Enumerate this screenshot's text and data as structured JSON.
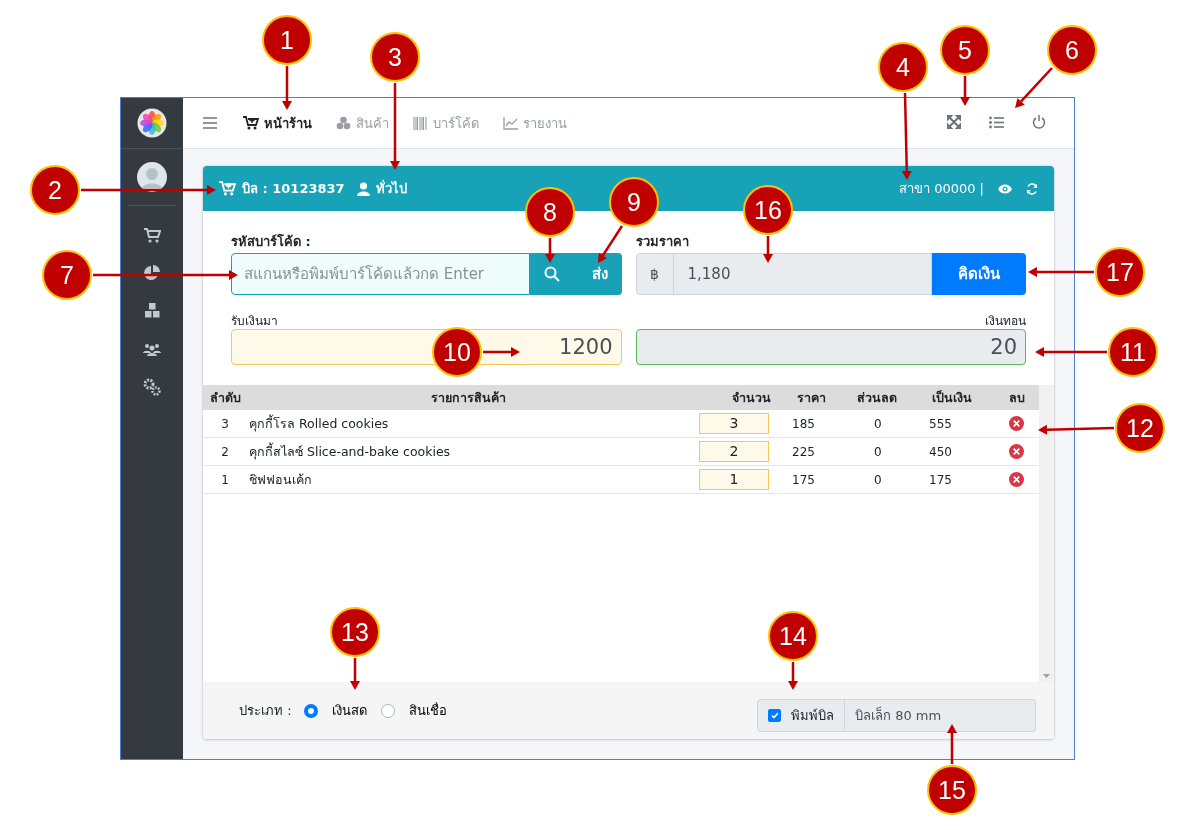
{
  "nav": {
    "items": [
      {
        "label": "หน้าร้าน",
        "selected": true
      },
      {
        "label": "สินค้า",
        "selected": false
      },
      {
        "label": "บาร์โค้ด",
        "selected": false
      },
      {
        "label": "รายงาน",
        "selected": false
      }
    ]
  },
  "bill_header": {
    "bill": "บิล : 10123837",
    "customer": "ทั่วไป",
    "branch": "สาขา 00000 |"
  },
  "barcode": {
    "label": "รหัสบาร์โค้ด :",
    "placeholder": "สแกนหรือพิมพ์บาร์โค้ดแล้วกด Enter",
    "send_button": "ส่ง"
  },
  "total": {
    "label": "รวมราคา",
    "currency": "฿",
    "value": "1,180",
    "button": "คิดเงิน"
  },
  "received": {
    "label": "รับเงินมา",
    "value": "1200"
  },
  "change": {
    "label": "เงินทอน",
    "value": "20"
  },
  "table": {
    "columns": [
      "ลำดับ",
      "รายการสินค้า",
      "จำนวน",
      "ราคา",
      "ส่วนลด",
      "เป็นเงิน",
      "ลบ"
    ],
    "rows": [
      {
        "no": "3",
        "name": "คุกกี้โรล Rolled cookies",
        "qty": "3",
        "price": "185",
        "discount": "0",
        "amount": "555"
      },
      {
        "no": "2",
        "name": "คุกกี้สไลซ์ Slice-and-bake cookies",
        "qty": "2",
        "price": "225",
        "discount": "0",
        "amount": "450"
      },
      {
        "no": "1",
        "name": "ชิฟฟอนเค้ก",
        "qty": "1",
        "price": "175",
        "discount": "0",
        "amount": "175"
      }
    ]
  },
  "payment_type": {
    "label": "ประเภท :",
    "options": [
      {
        "label": "เงินสด",
        "selected": true
      },
      {
        "label": "สินเชื่อ",
        "selected": false
      }
    ]
  },
  "print": {
    "label": "พิมพ์บิล",
    "checked": true,
    "paper": "บิลเล็ก 80 mm"
  },
  "callouts": [
    {
      "number": "1"
    },
    {
      "number": "2"
    },
    {
      "number": "3"
    },
    {
      "number": "4"
    },
    {
      "number": "5"
    },
    {
      "number": "6"
    },
    {
      "number": "7"
    },
    {
      "number": "8"
    },
    {
      "number": "9"
    },
    {
      "number": "10"
    },
    {
      "number": "11"
    },
    {
      "number": "12"
    },
    {
      "number": "13"
    },
    {
      "number": "14"
    },
    {
      "number": "15"
    },
    {
      "number": "16"
    },
    {
      "number": "17"
    }
  ]
}
